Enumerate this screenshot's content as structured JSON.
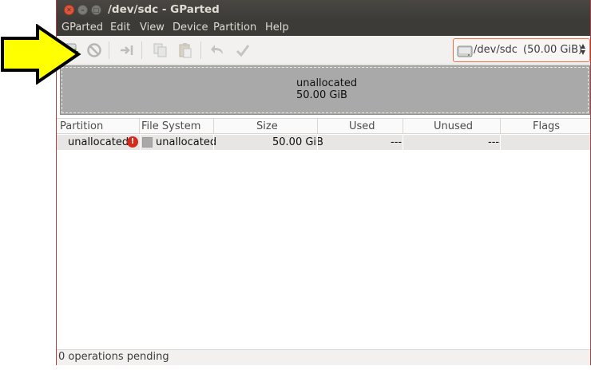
{
  "window": {
    "title": "/dev/sdc - GParted",
    "controls": [
      "close",
      "minimize",
      "maximize"
    ]
  },
  "menu": [
    "GParted",
    "Edit",
    "View",
    "Device",
    "Partition",
    "Help"
  ],
  "toolbar": {
    "icons": [
      "new-partition-icon",
      "delete-icon",
      "resize-move-icon",
      "copy-icon",
      "paste-icon",
      "undo-icon",
      "apply-icon"
    ],
    "device_selector": {
      "device": "/dev/sdc",
      "size": "(50.00 GiB)"
    }
  },
  "disk_map": {
    "label": "unallocated",
    "size": "50.00 GiB",
    "color": "#a9a9a9"
  },
  "table": {
    "columns": [
      "Partition",
      "File System",
      "Size",
      "Used",
      "Unused",
      "Flags"
    ],
    "rows": [
      {
        "partition": "unallocated",
        "filesystem": "unallocated",
        "size": "50.00 GiB",
        "used": "---",
        "unused": "---",
        "flags": ""
      }
    ]
  },
  "status": "0 operations pending",
  "colors": {
    "titlebar": "#3c3b37",
    "close_button": "#e2553b",
    "highlight_arrow": "#ffff00"
  }
}
